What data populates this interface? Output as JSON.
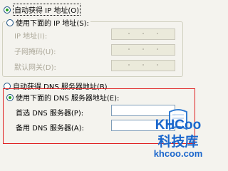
{
  "auto_ip_label": "自动获得 IP 地址(O)",
  "manual_ip_label": "使用下面的 IP 地址(S):",
  "ip_fields": [
    {
      "label": "IP 地址(I):"
    },
    {
      "label": "子网掩码(U):"
    },
    {
      "label": "默认网关(D):"
    }
  ],
  "auto_dns_label": "自动获得 DNS 服务器地址(B)",
  "manual_dns_label": "使用下面的 DNS 服务器地址(E):",
  "dns_fields": [
    {
      "label": "首选 DNS 服务器(P):"
    },
    {
      "label": "备用 DNS 服务器(A):"
    }
  ],
  "watermark": {
    "logo": "KHCoo",
    "cn": "科技库",
    "url": "khcoo.com"
  },
  "colors": {
    "selected_radio": "#21a121",
    "highlight_border": "#e02020"
  }
}
